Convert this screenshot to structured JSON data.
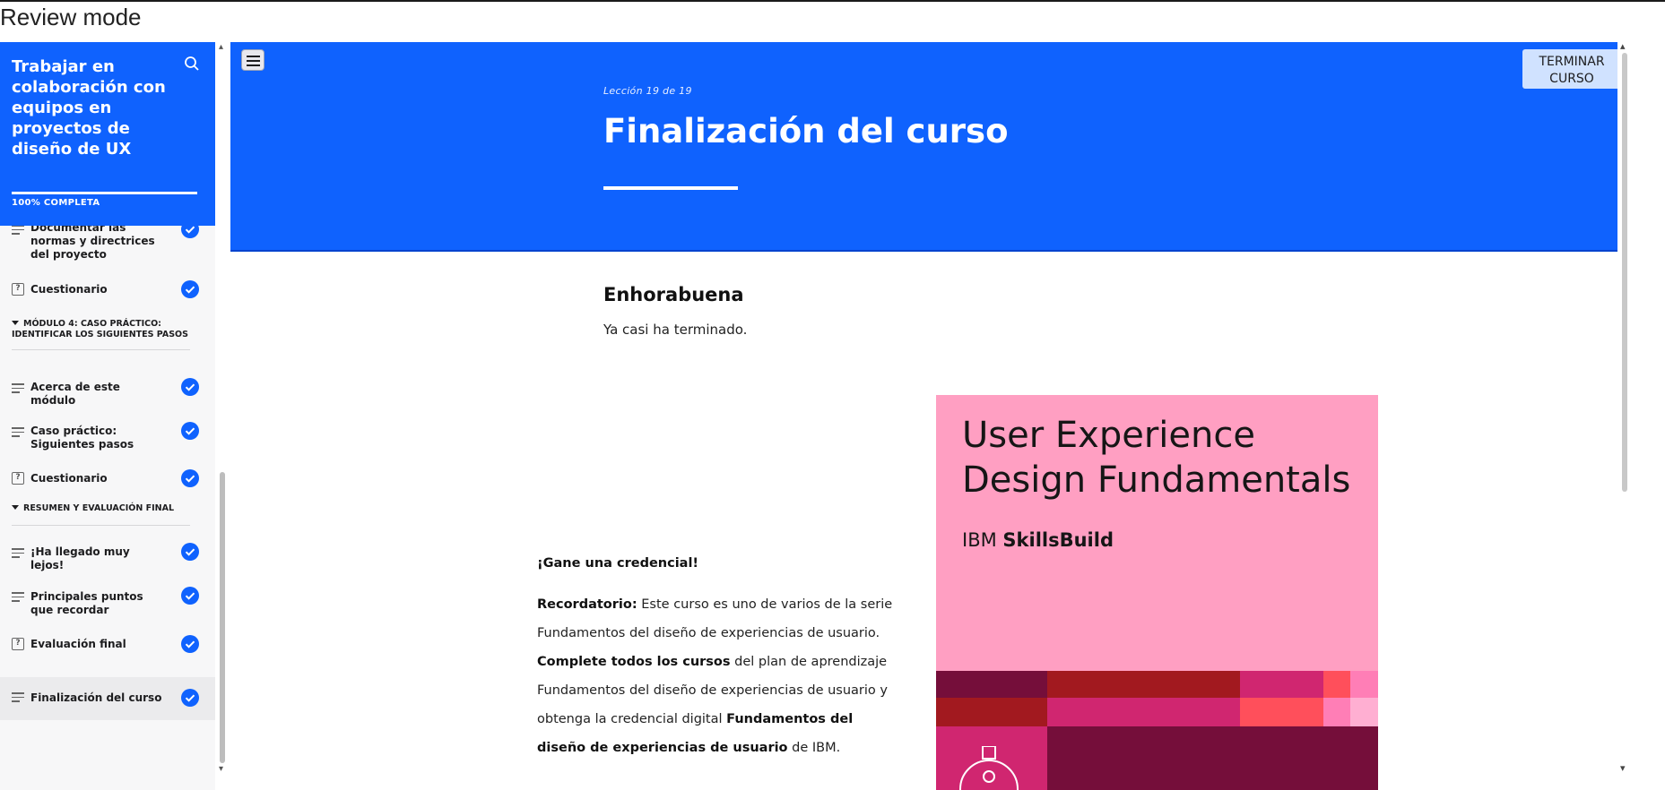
{
  "window": {
    "mode_label": "Review mode"
  },
  "sidebar": {
    "course_title": "Trabajar en colaboración con equipos en proyectos de diseño de UX",
    "progress_percent": 100,
    "progress_label": "100% COMPLETA",
    "items": [
      {
        "type": "lesson",
        "label": "Documentar las normas y directrices del proyecto",
        "completed": true
      },
      {
        "type": "quiz",
        "label": "Cuestionario",
        "completed": true
      },
      {
        "type": "section",
        "label": "MÓDULO 4: CASO PRÁCTICO: IDENTIFICAR LOS SIGUIENTES PASOS"
      },
      {
        "type": "lesson",
        "label": "Acerca de este módulo",
        "completed": true
      },
      {
        "type": "lesson",
        "label": "Caso práctico: Siguientes pasos",
        "completed": true
      },
      {
        "type": "quiz",
        "label": "Cuestionario",
        "completed": true
      },
      {
        "type": "section",
        "label": "RESUMEN Y EVALUACIÓN FINAL"
      },
      {
        "type": "lesson",
        "label": "¡Ha llegado muy lejos!",
        "completed": true
      },
      {
        "type": "lesson",
        "label": "Principales puntos que recordar",
        "completed": true
      },
      {
        "type": "quiz",
        "label": "Evaluación final",
        "completed": true
      },
      {
        "type": "lesson",
        "label": "Finalización del curso",
        "completed": true,
        "active": true
      }
    ]
  },
  "hero": {
    "lesson_counter": "Lección 19 de 19",
    "title": "Finalización del curso",
    "finish_button_line1": "TERMINAR",
    "finish_button_line2": "CURSO"
  },
  "content": {
    "heading": "Enhorabuena",
    "subtext": "Ya casi ha terminado.",
    "earn_heading": "¡Gane una credencial!",
    "para": {
      "reminder_label": "Recordatorio:",
      "reminder_text": " Este curso es uno de varios de la serie Fundamentos del diseño de experiencias de usuario. ",
      "complete_bold": "Complete todos los cursos",
      "complete_text": " del plan de aprendizaje Fundamentos del diseño de experiencias de usuario y obtenga la credencial digital ",
      "credential_bold": "Fundamentos del diseño de experiencias de usuario",
      "end_text": " de IBM."
    }
  },
  "badge": {
    "title": "User Experience Design Fundamentals",
    "brand_prefix": "IBM",
    "brand_name": "SkillsBuild",
    "colors": {
      "background": "#ff9fc2",
      "maroon": "#750e3a",
      "red": "#a2191f",
      "magenta": "#d02670",
      "coral": "#ff4f5b",
      "pink": "#ff7eb6",
      "light_pink": "#ffafd2"
    }
  },
  "colors": {
    "accent": "#0f62fe",
    "check": "#0f62fe",
    "finish_button_bg": "#d0e2ff"
  }
}
